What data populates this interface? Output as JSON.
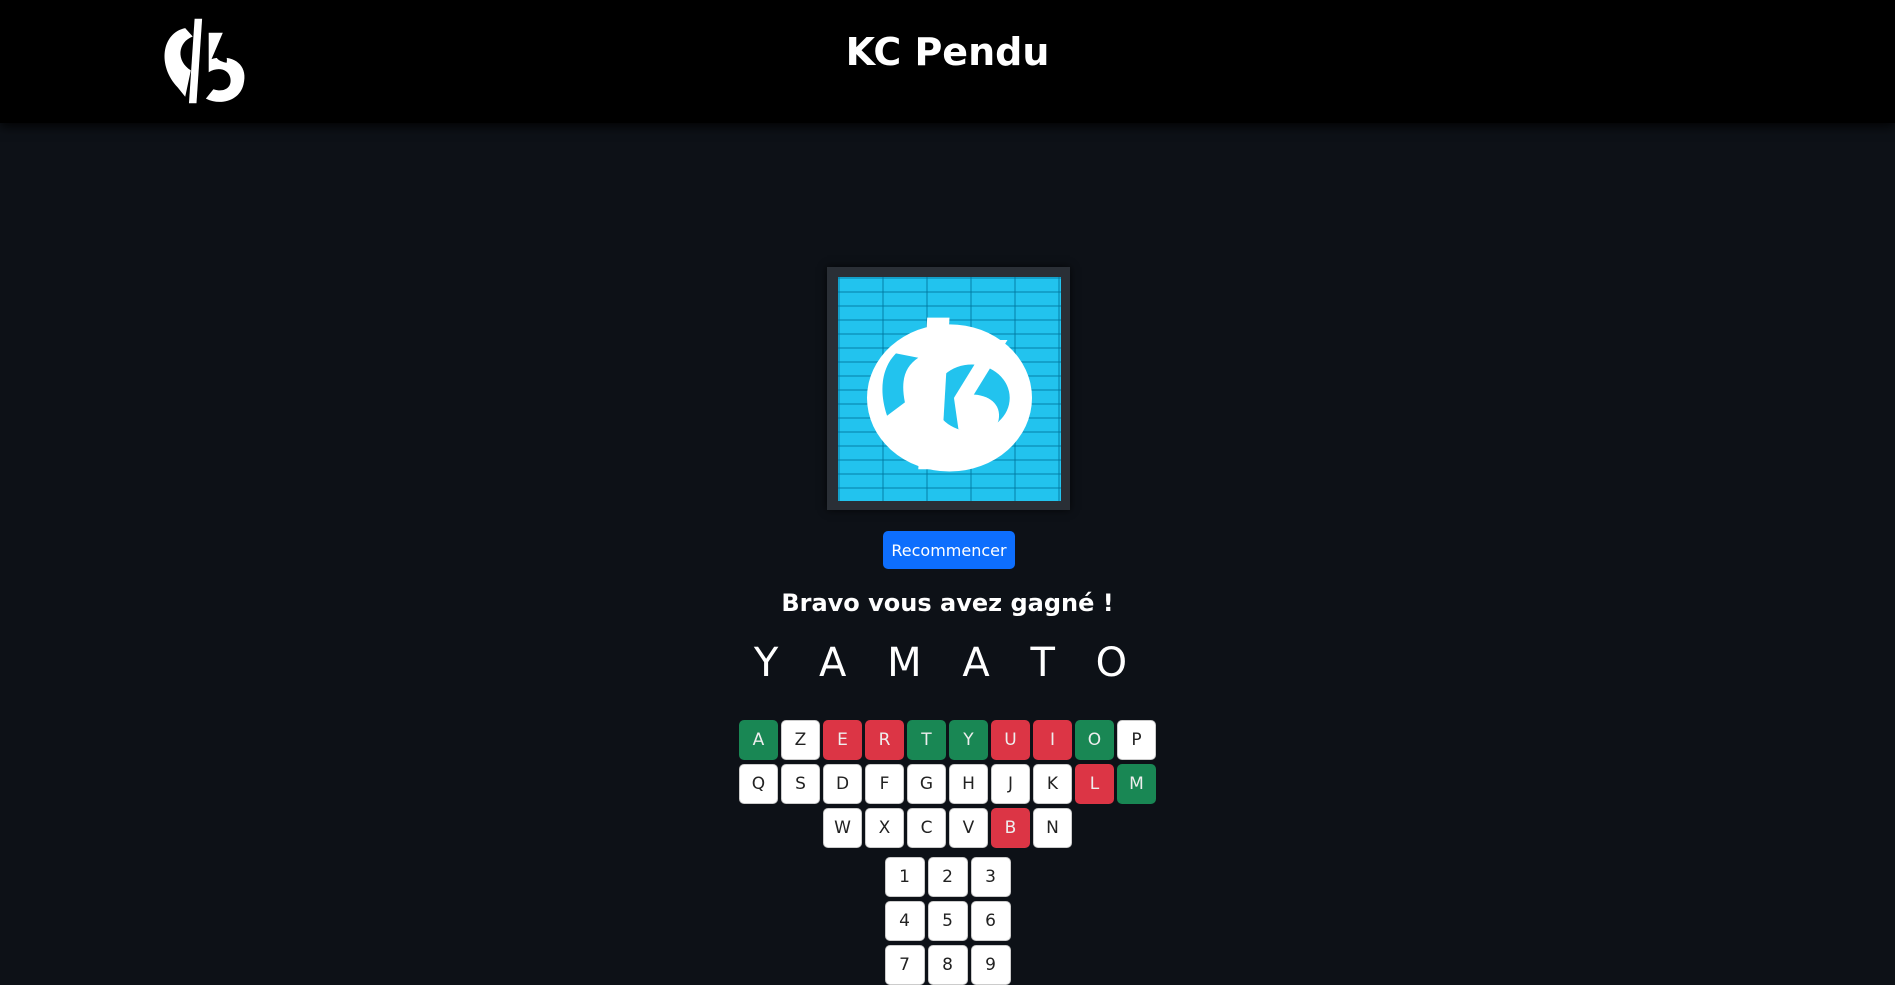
{
  "header": {
    "title": "KC Pendu",
    "logo": "kc-logo-icon"
  },
  "picture": {
    "icon": "kc-logo-icon",
    "background": "#22c3ee"
  },
  "restart_label": "Recommencer",
  "result_text": "Bravo vous avez gagné !",
  "word": "Y A M A T O",
  "colors": {
    "hit": "#198754",
    "miss": "#dc3545",
    "button": "#0d6efd"
  },
  "keyboard": {
    "row1": [
      {
        "k": "A",
        "s": "hit"
      },
      {
        "k": "Z",
        "s": ""
      },
      {
        "k": "E",
        "s": "miss"
      },
      {
        "k": "R",
        "s": "miss"
      },
      {
        "k": "T",
        "s": "hit"
      },
      {
        "k": "Y",
        "s": "hit"
      },
      {
        "k": "U",
        "s": "miss"
      },
      {
        "k": "I",
        "s": "miss"
      },
      {
        "k": "O",
        "s": "hit"
      },
      {
        "k": "P",
        "s": ""
      }
    ],
    "row2": [
      {
        "k": "Q",
        "s": ""
      },
      {
        "k": "S",
        "s": ""
      },
      {
        "k": "D",
        "s": ""
      },
      {
        "k": "F",
        "s": ""
      },
      {
        "k": "G",
        "s": ""
      },
      {
        "k": "H",
        "s": ""
      },
      {
        "k": "J",
        "s": ""
      },
      {
        "k": "K",
        "s": ""
      },
      {
        "k": "L",
        "s": "miss"
      },
      {
        "k": "M",
        "s": "hit"
      }
    ],
    "row3": [
      {
        "k": "W",
        "s": ""
      },
      {
        "k": "X",
        "s": ""
      },
      {
        "k": "C",
        "s": ""
      },
      {
        "k": "V",
        "s": ""
      },
      {
        "k": "B",
        "s": "miss"
      },
      {
        "k": "N",
        "s": ""
      }
    ],
    "num1": [
      {
        "k": "1",
        "s": ""
      },
      {
        "k": "2",
        "s": ""
      },
      {
        "k": "3",
        "s": ""
      }
    ],
    "num2": [
      {
        "k": "4",
        "s": ""
      },
      {
        "k": "5",
        "s": ""
      },
      {
        "k": "6",
        "s": ""
      }
    ],
    "num3": [
      {
        "k": "7",
        "s": ""
      },
      {
        "k": "8",
        "s": ""
      },
      {
        "k": "9",
        "s": ""
      }
    ]
  }
}
